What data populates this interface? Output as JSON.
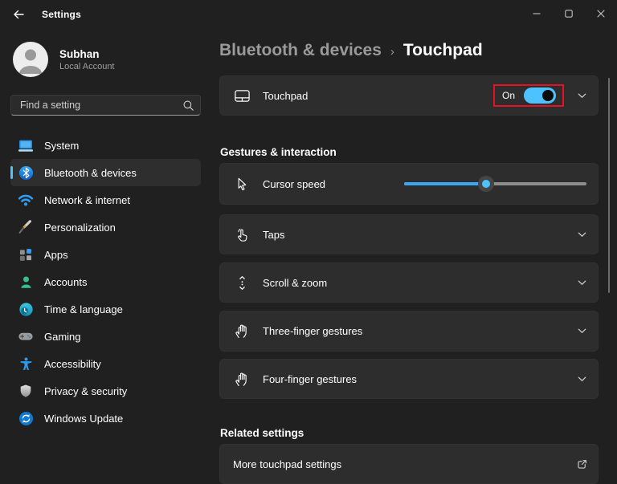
{
  "titlebar": {
    "title": "Settings"
  },
  "window_controls": [
    "minimize",
    "maximize",
    "close"
  ],
  "user": {
    "name": "Subhan",
    "account_type": "Local Account"
  },
  "search": {
    "placeholder": "Find a setting"
  },
  "sidebar": {
    "items": [
      {
        "label": "System",
        "icon": "system-icon",
        "selected": false
      },
      {
        "label": "Bluetooth & devices",
        "icon": "bluetooth-icon",
        "selected": true
      },
      {
        "label": "Network & internet",
        "icon": "network-icon",
        "selected": false
      },
      {
        "label": "Personalization",
        "icon": "personalization-icon",
        "selected": false
      },
      {
        "label": "Apps",
        "icon": "apps-icon",
        "selected": false
      },
      {
        "label": "Accounts",
        "icon": "accounts-icon",
        "selected": false
      },
      {
        "label": "Time & language",
        "icon": "time-language-icon",
        "selected": false
      },
      {
        "label": "Gaming",
        "icon": "gaming-icon",
        "selected": false
      },
      {
        "label": "Accessibility",
        "icon": "accessibility-icon",
        "selected": false
      },
      {
        "label": "Privacy & security",
        "icon": "privacy-icon",
        "selected": false
      },
      {
        "label": "Windows Update",
        "icon": "windows-update-icon",
        "selected": false
      }
    ]
  },
  "main": {
    "breadcrumb": {
      "parent": "Bluetooth & devices",
      "separator": "›",
      "current": "Touchpad"
    },
    "touchpad": {
      "label": "Touchpad",
      "toggle_state": "On",
      "toggle_on": true,
      "highlighted": true,
      "icon": "touchpad-icon"
    },
    "sections": {
      "gestures": "Gestures & interaction",
      "related": "Related settings"
    },
    "cursor_speed": {
      "label": "Cursor speed",
      "value_pct": 45,
      "icon": "cursor-icon"
    },
    "expanders": [
      {
        "label": "Taps",
        "icon": "tap-finger-icon"
      },
      {
        "label": "Scroll & zoom",
        "icon": "scroll-icon"
      },
      {
        "label": "Three-finger gestures",
        "icon": "hand-icon"
      },
      {
        "label": "Four-finger gestures",
        "icon": "hand-icon"
      }
    ],
    "related_items": [
      {
        "label": "More touchpad settings",
        "icon": "external-link-icon"
      }
    ]
  },
  "colors": {
    "window_bg": "#202020",
    "card_bg": "#2d2d2d",
    "accent": "#4cc2ff",
    "highlight_red": "#e81123",
    "secondary_text": "#9d9d9d"
  }
}
